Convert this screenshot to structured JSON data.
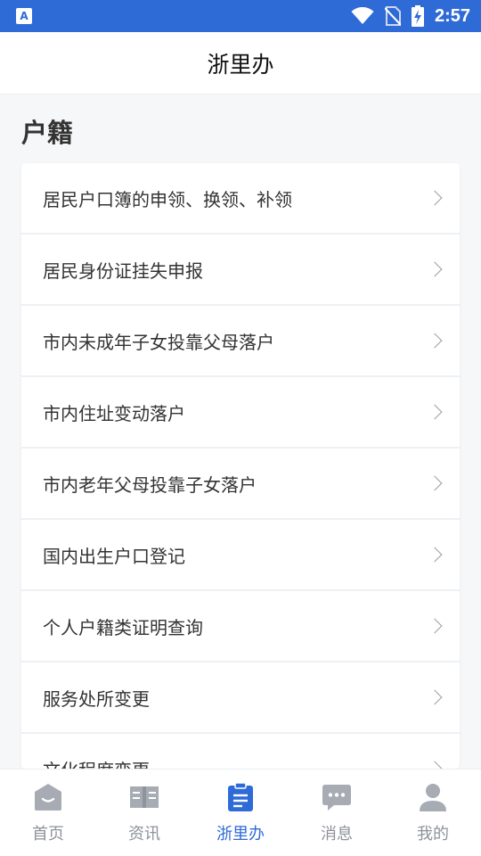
{
  "status_bar": {
    "time": "2:57"
  },
  "header": {
    "title": "浙里办"
  },
  "section": {
    "title": "户籍"
  },
  "services": [
    {
      "label": "居民户口簿的申领、换领、补领"
    },
    {
      "label": "居民身份证挂失申报"
    },
    {
      "label": "市内未成年子女投靠父母落户"
    },
    {
      "label": "市内住址变动落户"
    },
    {
      "label": "市内老年父母投靠子女落户"
    },
    {
      "label": "国内出生户口登记"
    },
    {
      "label": "个人户籍类证明查询"
    },
    {
      "label": "服务处所变更"
    },
    {
      "label": "文化程度变更"
    }
  ],
  "bottom_nav": {
    "items": [
      {
        "label": "首页",
        "icon": "home-icon"
      },
      {
        "label": "资讯",
        "icon": "book-icon"
      },
      {
        "label": "浙里办",
        "icon": "clipboard-icon",
        "active": true
      },
      {
        "label": "消息",
        "icon": "chat-icon"
      },
      {
        "label": "我的",
        "icon": "user-icon"
      }
    ]
  },
  "colors": {
    "accent": "#2f6bd7",
    "nav_inactive": "#8e9299",
    "nav_icon_inactive": "#a7abb3"
  }
}
